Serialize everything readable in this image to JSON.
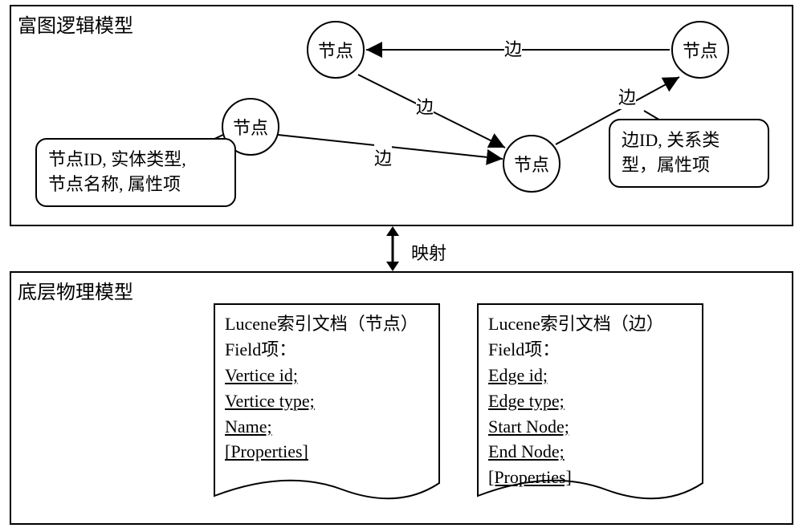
{
  "panels": {
    "top_title": "富图逻辑模型",
    "bot_title": "底层物理模型"
  },
  "mapping_label": "映射",
  "node_label": "节点",
  "edge_label": "边",
  "bubbles": {
    "node_desc_l1": "节点ID, 实体类型,",
    "node_desc_l2": "节点名称, 属性项",
    "edge_desc_l1": "边ID, 关系类",
    "edge_desc_l2": "型，属性项"
  },
  "docs": {
    "node": {
      "title": "Lucene索引文档（节点）",
      "field_label": "Field项：",
      "f1": "Vertice id;",
      "f2": "Vertice type;",
      "f3": "Name;",
      "f4": "[Properties]"
    },
    "edge": {
      "title": "Lucene索引文档（边）",
      "field_label": "Field项：",
      "f1": "Edge id;",
      "f2": "Edge type;",
      "f3": "Start Node;",
      "f4": "End Node;",
      "f5": "[Properties]"
    }
  }
}
